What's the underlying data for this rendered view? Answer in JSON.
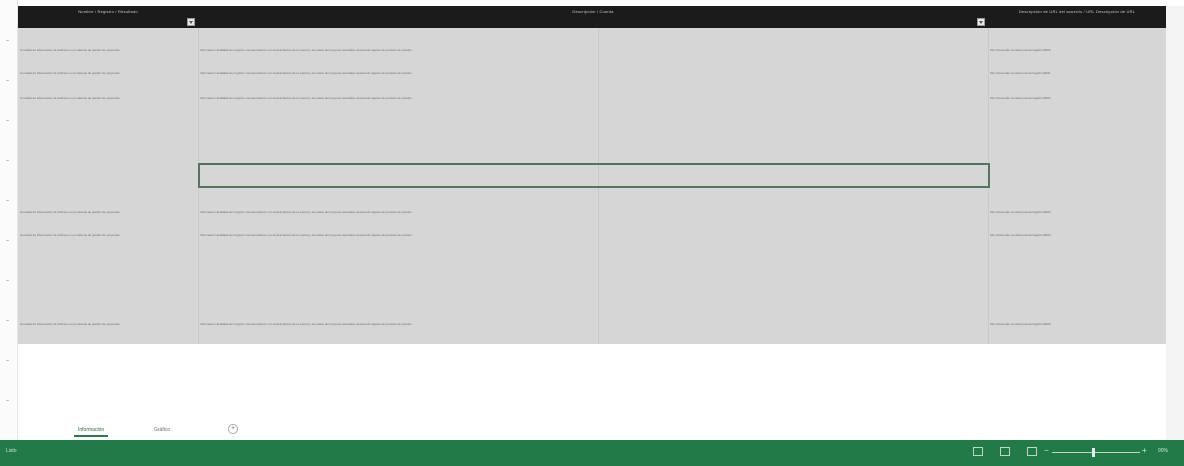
{
  "header": {
    "col1": "Nombre / Registro / Resultado",
    "col2": "Descripción / Cuenta",
    "col3": "Descripción de URL del acuerdo / URL Descripción de URL"
  },
  "rows": [
    {
      "c1": "Consulta de información de archivos en el sistema de gestión de proyectos",
      "c2": "Información detallada del registro correspondiente con la descripción de la cuenta y los datos del proyecto asociados al acuerdo vigente del periodo de revisión",
      "c3": "http://www.sitio.com/documento/registro/0000"
    },
    {
      "c1": "Consulta de información de archivos en el sistema de gestión de proyectos",
      "c2": "Información detallada del registro correspondiente con la descripción de la cuenta y los datos del proyecto asociados al acuerdo vigente del periodo de revisión",
      "c3": "http://www.sitio.com/documento/registro/0001"
    },
    {
      "c1": "Consulta de información de archivos en el sistema de gestión de proyectos",
      "c2": "Información detallada del registro correspondiente con la descripción de la cuenta y los datos del proyecto asociados al acuerdo vigente del periodo de revisión",
      "c3": "http://www.sitio.com/documento/registro/0002"
    },
    {
      "c1": "Consulta de información de archivos en el sistema de gestión de proyectos",
      "c2": "Información detallada del registro correspondiente con la descripción de la cuenta y los datos del proyecto asociados al acuerdo vigente del periodo de revisión",
      "c3": "http://www.sitio.com/documento/registro/0003"
    },
    {
      "c1": "Consulta de información de archivos en el sistema de gestión de proyectos",
      "c2": "Información detallada del registro correspondiente con la descripción de la cuenta y los datos del proyecto asociados al acuerdo vigente del periodo de revisión",
      "c3": "http://www.sitio.com/documento/registro/0004"
    },
    {
      "c1": "Consulta de información de archivos en el sistema de gestión de proyectos",
      "c2": "Información detallada del registro correspondiente con la descripción de la cuenta y los datos del proyecto asociados al acuerdo vigente del periodo de revisión",
      "c3": "http://www.sitio.com/documento/registro/0005"
    }
  ],
  "tabs": {
    "active": "Información",
    "second": "Gráfico",
    "add_icon": "plus-icon"
  },
  "status": {
    "ready": "Listo",
    "zoom": "90%",
    "colors": {
      "status_bar": "#227a48",
      "header": "#1b1b1b"
    }
  }
}
